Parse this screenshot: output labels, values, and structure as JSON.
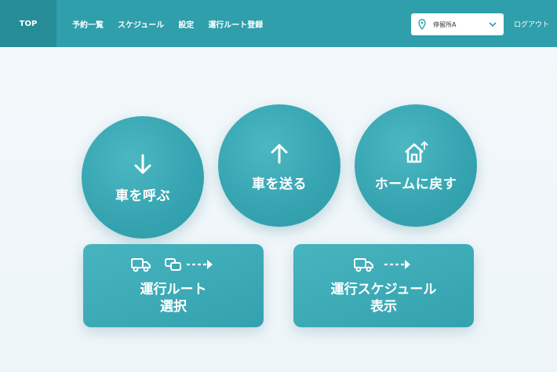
{
  "nav": {
    "top": "TOP",
    "items": [
      "予約一覧",
      "スケジュール",
      "設定",
      "運行ルート登録"
    ],
    "location": "停留所A",
    "logout": "ログアウト"
  },
  "actions": {
    "call": "車を呼ぶ",
    "send": "車を送る",
    "home": "ホームに戻す",
    "route_line1": "運行ルート",
    "route_line2": "選択",
    "schedule_line1": "運行スケジュール",
    "schedule_line2": "表示"
  },
  "colors": {
    "primary": "#2e9fab",
    "primary_dark": "#268c97",
    "background": "#f3f8fb"
  }
}
